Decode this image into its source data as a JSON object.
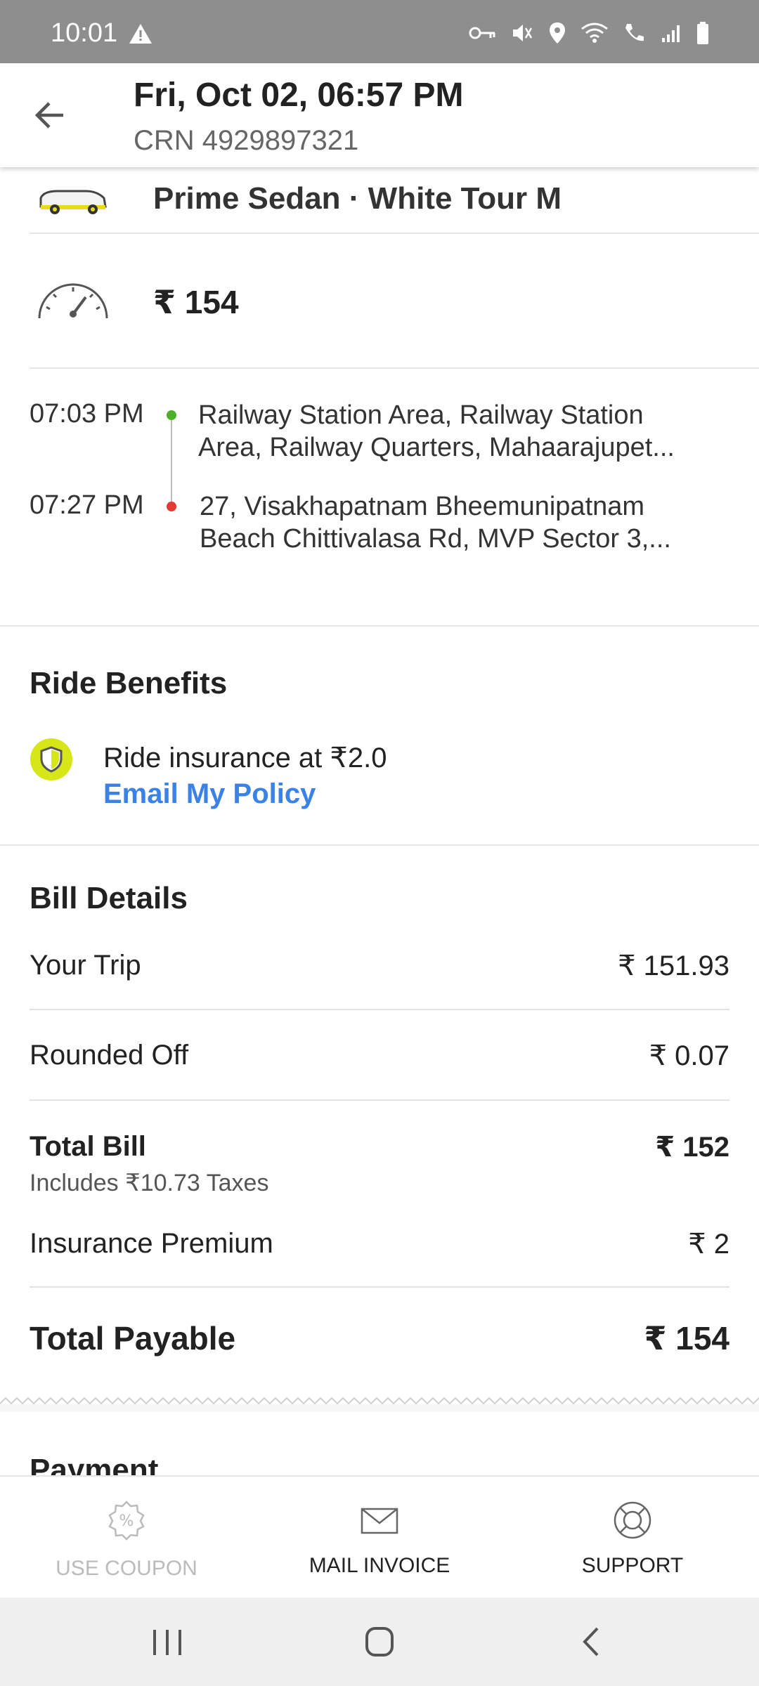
{
  "status_bar": {
    "time": "10:01"
  },
  "header": {
    "title": "Fri, Oct 02, 06:57 PM",
    "crn": "CRN 4929897321"
  },
  "cab": {
    "description": "Prime Sedan · White Tour M"
  },
  "fare": {
    "amount": "₹ 154"
  },
  "route": {
    "pickup_time": "07:03 PM",
    "pickup_address_line1": "Railway Station Area, Railway Station",
    "pickup_address_line2": "Area, Railway Quarters, Mahaarajupet...",
    "drop_time": "07:27 PM",
    "drop_address_line1": "27, Visakhapatnam Bheemunipatnam",
    "drop_address_line2": "Beach Chittivalasa Rd, MVP Sector 3,..."
  },
  "ride_benefits": {
    "title": "Ride Benefits",
    "insurance_text": "Ride insurance at ₹2.0",
    "email_policy": "Email My Policy"
  },
  "bill": {
    "title": "Bill Details",
    "your_trip_label": "Your Trip",
    "your_trip_value": "₹ 151.93",
    "rounded_label": "Rounded Off",
    "rounded_value": "₹ 0.07",
    "total_bill_label": "Total Bill",
    "total_bill_value": "₹ 152",
    "taxes_note": "Includes ₹10.73 Taxes",
    "insurance_label": "Insurance Premium",
    "insurance_value": "₹ 2",
    "payable_label": "Total Payable",
    "payable_value": "₹ 154"
  },
  "payment": {
    "title": "Payment"
  },
  "actions": {
    "coupon": "USE COUPON",
    "mail_invoice": "MAIL INVOICE",
    "support": "SUPPORT"
  },
  "colors": {
    "link": "#3b82e6",
    "pickup_dot": "#4caf2a",
    "drop_dot": "#e53935",
    "shield": "#d6e619"
  }
}
